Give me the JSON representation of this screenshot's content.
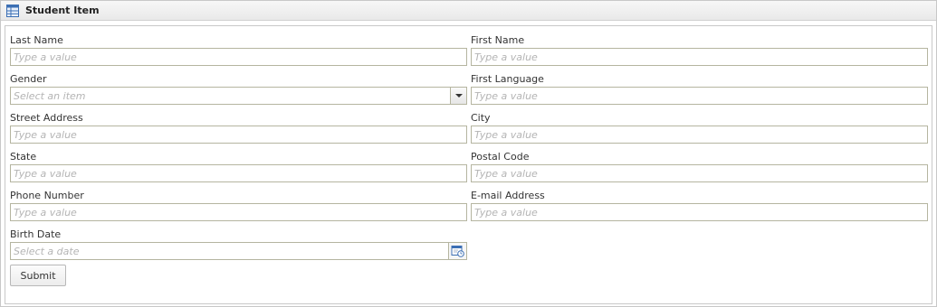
{
  "panel": {
    "title": "Student Item",
    "icon": "table-grid-icon"
  },
  "form": {
    "fields": {
      "last_name": {
        "label": "Last Name",
        "value": "",
        "placeholder": "Type a value"
      },
      "first_name": {
        "label": "First Name",
        "value": "",
        "placeholder": "Type a value"
      },
      "gender": {
        "label": "Gender",
        "value": "",
        "placeholder": "Select an item",
        "icon": "chevron-down-icon"
      },
      "first_language": {
        "label": "First Language",
        "value": "",
        "placeholder": "Type a value"
      },
      "street_address": {
        "label": "Street Address",
        "value": "",
        "placeholder": "Type a value"
      },
      "city": {
        "label": "City",
        "value": "",
        "placeholder": "Type a value"
      },
      "state": {
        "label": "State",
        "value": "",
        "placeholder": "Type a value"
      },
      "postal_code": {
        "label": "Postal Code",
        "value": "",
        "placeholder": "Type a value"
      },
      "phone_number": {
        "label": "Phone Number",
        "value": "",
        "placeholder": "Type a value"
      },
      "email_address": {
        "label": "E-mail Address",
        "value": "",
        "placeholder": "Type a value"
      },
      "birth_date": {
        "label": "Birth Date",
        "value": "",
        "placeholder": "Select a date",
        "icon": "calendar-icon"
      }
    },
    "submit_label": "Submit"
  },
  "colors": {
    "border": "#b5b5a0",
    "placeholder": "#b4b4b4",
    "header_bg": "#efefef",
    "icon_blue": "#3c6fb4"
  }
}
